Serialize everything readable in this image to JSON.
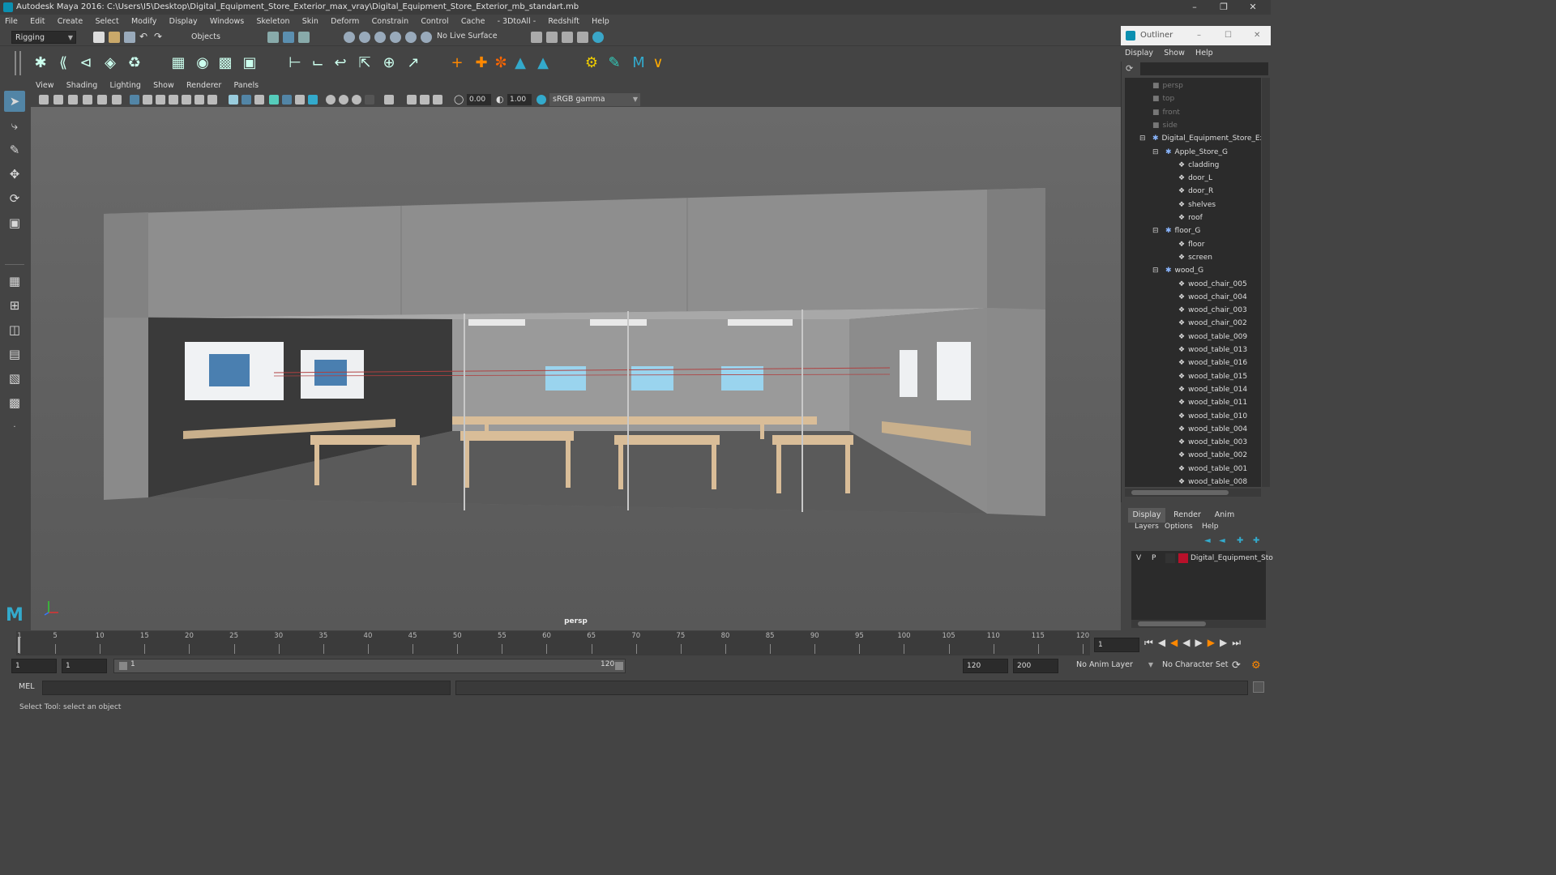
{
  "window": {
    "title": "Autodesk Maya 2016: C:\\Users\\I5\\Desktop\\Digital_Equipment_Store_Exterior_max_vray\\Digital_Equipment_Store_Exterior_mb_standart.mb"
  },
  "menubar": {
    "items": [
      "File",
      "Edit",
      "Create",
      "Select",
      "Modify",
      "Display",
      "Windows",
      "Skeleton",
      "Skin",
      "Deform",
      "Constrain",
      "Control",
      "Cache",
      "- 3DtoAll -",
      "Redshift",
      "Help"
    ]
  },
  "statusline": {
    "menuset": "Rigging",
    "selection_mode": "Objects",
    "live_surface": "No Live Surface"
  },
  "panel": {
    "menus": [
      "View",
      "Shading",
      "Lighting",
      "Show",
      "Renderer",
      "Panels"
    ],
    "exposure": "0.00",
    "gamma": "1.00",
    "color_space": "sRGB gamma",
    "camera": "persp"
  },
  "outliner": {
    "title": "Outliner",
    "menus": [
      "Display",
      "Show",
      "Help"
    ],
    "items": [
      {
        "label": "persp",
        "depth": 0,
        "kind": "camera",
        "dim": true
      },
      {
        "label": "top",
        "depth": 0,
        "kind": "camera",
        "dim": true
      },
      {
        "label": "front",
        "depth": 0,
        "kind": "camera",
        "dim": true
      },
      {
        "label": "side",
        "depth": 0,
        "kind": "camera",
        "dim": true
      },
      {
        "label": "Digital_Equipment_Store_Ext",
        "depth": 0,
        "kind": "group",
        "dim": false
      },
      {
        "label": "Apple_Store_G",
        "depth": 1,
        "kind": "group",
        "dim": false
      },
      {
        "label": "cladding",
        "depth": 2,
        "kind": "mesh",
        "dim": false
      },
      {
        "label": "door_L",
        "depth": 2,
        "kind": "mesh",
        "dim": false
      },
      {
        "label": "door_R",
        "depth": 2,
        "kind": "mesh",
        "dim": false
      },
      {
        "label": "shelves",
        "depth": 2,
        "kind": "mesh",
        "dim": false
      },
      {
        "label": "roof",
        "depth": 2,
        "kind": "mesh",
        "dim": false
      },
      {
        "label": "floor_G",
        "depth": 1,
        "kind": "group",
        "dim": false
      },
      {
        "label": "floor",
        "depth": 2,
        "kind": "mesh",
        "dim": false
      },
      {
        "label": "screen",
        "depth": 2,
        "kind": "mesh",
        "dim": false
      },
      {
        "label": "wood_G",
        "depth": 1,
        "kind": "group",
        "dim": false
      },
      {
        "label": "wood_chair_005",
        "depth": 2,
        "kind": "mesh",
        "dim": false
      },
      {
        "label": "wood_chair_004",
        "depth": 2,
        "kind": "mesh",
        "dim": false
      },
      {
        "label": "wood_chair_003",
        "depth": 2,
        "kind": "mesh",
        "dim": false
      },
      {
        "label": "wood_chair_002",
        "depth": 2,
        "kind": "mesh",
        "dim": false
      },
      {
        "label": "wood_table_009",
        "depth": 2,
        "kind": "mesh",
        "dim": false
      },
      {
        "label": "wood_table_013",
        "depth": 2,
        "kind": "mesh",
        "dim": false
      },
      {
        "label": "wood_table_016",
        "depth": 2,
        "kind": "mesh",
        "dim": false
      },
      {
        "label": "wood_table_015",
        "depth": 2,
        "kind": "mesh",
        "dim": false
      },
      {
        "label": "wood_table_014",
        "depth": 2,
        "kind": "mesh",
        "dim": false
      },
      {
        "label": "wood_table_011",
        "depth": 2,
        "kind": "mesh",
        "dim": false
      },
      {
        "label": "wood_table_010",
        "depth": 2,
        "kind": "mesh",
        "dim": false
      },
      {
        "label": "wood_table_004",
        "depth": 2,
        "kind": "mesh",
        "dim": false
      },
      {
        "label": "wood_table_003",
        "depth": 2,
        "kind": "mesh",
        "dim": false
      },
      {
        "label": "wood_table_002",
        "depth": 2,
        "kind": "mesh",
        "dim": false
      },
      {
        "label": "wood_table_001",
        "depth": 2,
        "kind": "mesh",
        "dim": false
      },
      {
        "label": "wood_table_008",
        "depth": 2,
        "kind": "mesh",
        "dim": false
      }
    ]
  },
  "layer_editor": {
    "tabs": [
      "Display",
      "Render",
      "Anim"
    ],
    "menus": [
      "Layers",
      "Options",
      "Help"
    ],
    "layer": {
      "v": "V",
      "p": "P",
      "name": "Digital_Equipment_Sto",
      "color": "#b8102a"
    }
  },
  "timeslider": {
    "ticks": [
      "1",
      "5",
      "10",
      "15",
      "20",
      "25",
      "30",
      "35",
      "40",
      "45",
      "50",
      "55",
      "60",
      "65",
      "70",
      "75",
      "80",
      "85",
      "90",
      "95",
      "100",
      "105",
      "110",
      "115",
      "120"
    ],
    "current_frame": "1"
  },
  "range": {
    "start": "1",
    "playback_start": "1",
    "slider_start": "1",
    "slider_end": "120",
    "playback_end": "120",
    "end": "200",
    "anim_layer": "No Anim Layer",
    "character_set": "No Character Set"
  },
  "command": {
    "language": "MEL",
    "help_text": "Select Tool: select an object"
  }
}
